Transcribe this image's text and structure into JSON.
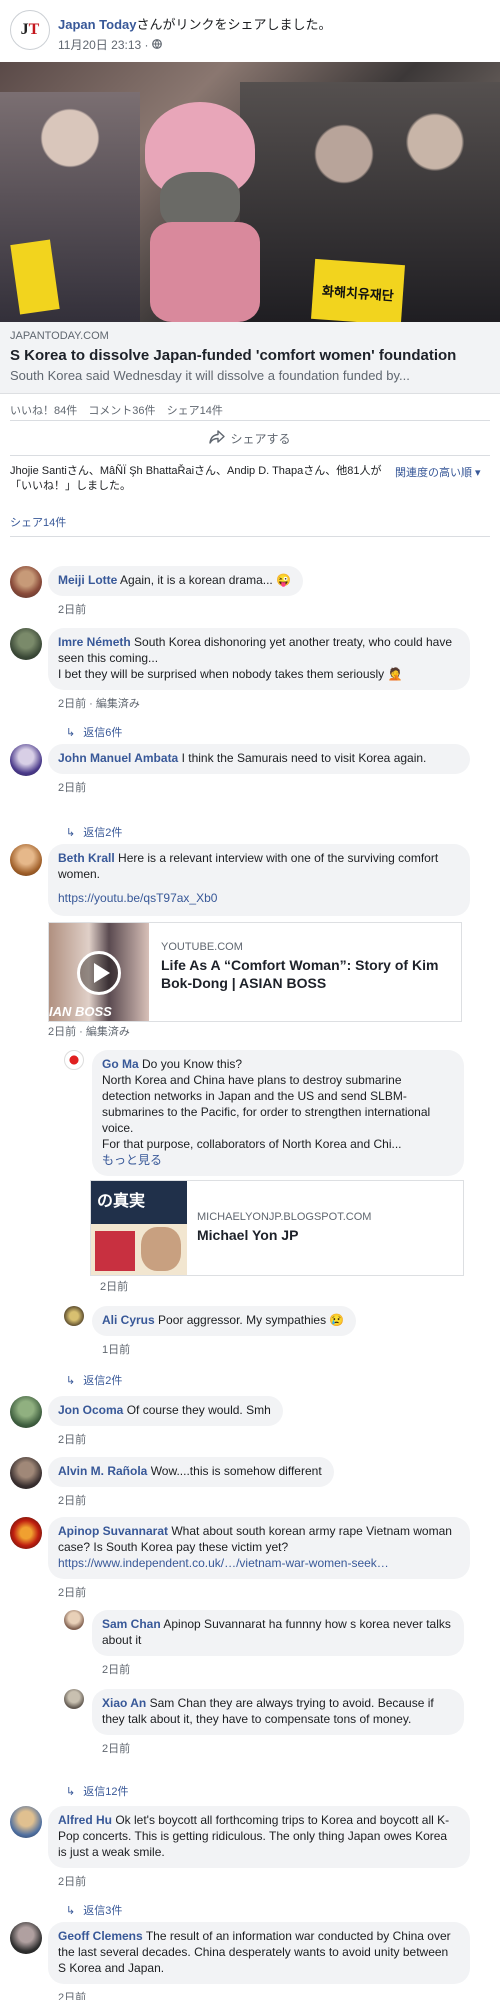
{
  "post": {
    "page_name": "Japan Today",
    "shared_text": "さんがリンクをシェアしました。",
    "timestamp": "11月20日 23:13 · ",
    "link": {
      "domain": "JAPANTODAY.COM",
      "title": "S Korea to dissolve Japan-funded 'comfort women' foundation",
      "description": "South Korea said Wednesday it will dissolve a foundation funded by..."
    },
    "hero_sign_text": "화해치유재단",
    "stats": {
      "likes": "いいね！84件",
      "comments": "コメント36件",
      "shares": "シェア14件"
    },
    "share_button": "シェアする",
    "likers": "Jhojie Santiさん、MâÑÏ Şh BhattaŘaiさん、Andip D. Thapaさん、他81人が「いいね！」しました。",
    "sort_label": "関連度の高い順 ▾",
    "shares_link": "シェア14件"
  },
  "comments": [
    {
      "name": "Meiji Lotte",
      "text": "Again, it is a korean drama... 😜",
      "meta": "2日前"
    },
    {
      "name": "Imre Németh",
      "text": "South Korea dishonoring yet another treaty, who could have seen this coming...",
      "text2": "I bet they will be surprised when nobody takes them seriously 🤦",
      "meta": "2日前 · 編集済み",
      "replies": "返信6件"
    },
    {
      "name": "John Manuel Ambata",
      "text": "I think the Samurais need to visit Korea again.",
      "meta": "2日前",
      "replies": "返信2件"
    },
    {
      "name": "Beth Krall",
      "text": "Here is a relevant interview with one of the surviving comfort women.",
      "link": "https://youtu.be/qsT97ax_Xb0",
      "meta": "2日前 · 編集済み",
      "attachment": {
        "domain": "YOUTUBE.COM",
        "title": "Life As A “Comfort Woman”: Story of Kim Bok-Dong | ASIAN BOSS",
        "thumb_text": "IAN BOSS"
      }
    },
    {
      "name": "Go Ma",
      "text": "Do you Know this?",
      "text2": "North Korea and China have plans to destroy submarine detection networks in Japan and the US and send SLBM-submarines to the Pacific, for order to strengthen international voice.",
      "text3": "For that purpose, collaborators of North Korea and Chi...",
      "more": "もっと見る",
      "meta": "2日前",
      "attachment": {
        "domain": "MICHAELYONJP.BLOGSPOT.COM",
        "title": "Michael Yon JP",
        "thumb_text": "の真実"
      }
    },
    {
      "name": "Ali Cyrus",
      "text": "Poor aggressor. My sympathies 😢",
      "meta": "1日前"
    },
    {
      "replies": "返信2件"
    },
    {
      "name": "Jon Ocoma",
      "text": "Of course they would. Smh",
      "meta": "2日前"
    },
    {
      "name": "Alvin M. Rañola",
      "text": "Wow....this is somehow different",
      "meta": "2日前"
    },
    {
      "name": "Apinop Suvannarat",
      "text": "What about south korean army rape Vietnam woman case? Is South Korea pay these victim yet?",
      "link": "https://www.independent.co.uk/…/vietnam-war-women-seek…",
      "meta": "2日前"
    },
    {
      "name": "Sam Chan",
      "text": "Apinop Suvannarat ha funnny how s korea never talks about it",
      "meta": "2日前"
    },
    {
      "name": "Xiao An",
      "text": "Sam Chan they are always trying to avoid. Because if they talk about it, they have to compensate tons of money.",
      "meta": "2日前"
    },
    {
      "replies": "返信12件"
    },
    {
      "name": "Alfred Hu",
      "text": "Ok let's boycott all forthcoming trips to Korea and boycott all K-Pop concerts. This is getting ridiculous. The only thing Japan owes Korea is just a weak smile.",
      "meta": "2日前",
      "replies": "返信3件"
    },
    {
      "name": "Geoff Clemens",
      "text": "The result of an information war conducted by China over the last several decades. China desperately wants to avoid unity between S Korea and Japan.",
      "meta": "2日前"
    }
  ]
}
